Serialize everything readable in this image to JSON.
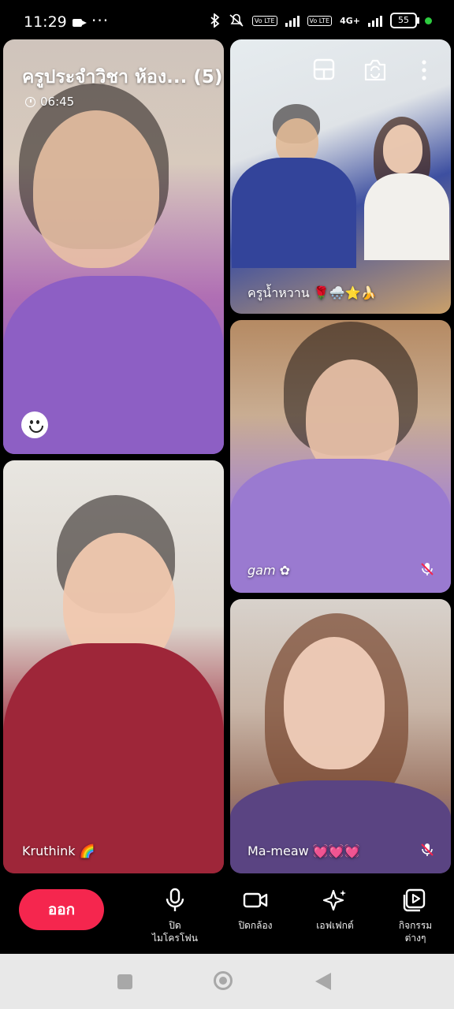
{
  "status_bar": {
    "time": "11:29",
    "overflow": "···",
    "volte1": "Vo LTE",
    "volte2": "Vo LTE",
    "network": "4G+",
    "battery": "55"
  },
  "meeting": {
    "title": "ครูประจำวิชา ห้อง... (5)",
    "duration": "06:45"
  },
  "participants": [
    {
      "name": "",
      "muted": false
    },
    {
      "name": "ครูน้ำหวาน 🌹🌨️⭐🍌",
      "muted": false
    },
    {
      "name": "gam ✿",
      "muted": true
    },
    {
      "name": "Kruthink 🌈",
      "muted": false
    },
    {
      "name": "Ma-meaw 💓💓💓",
      "muted": true
    }
  ],
  "toolbar": {
    "leave_label": "ออก",
    "mic_label_line1": "ปิด",
    "mic_label_line2": "ไมโครโฟน",
    "camera_label": "ปิดกล้อง",
    "effects_label": "เอฟเฟกต์",
    "activities_label_line1": "กิจกรรม",
    "activities_label_line2": "ต่างๆ"
  },
  "colors": {
    "leave_button": "#f5264e",
    "background": "#000000",
    "nav_bar": "#e8e8e8"
  }
}
